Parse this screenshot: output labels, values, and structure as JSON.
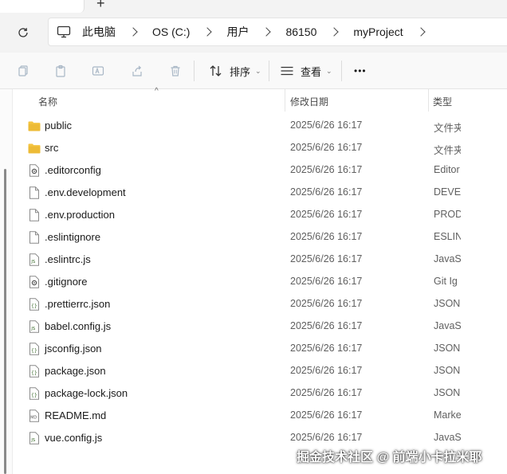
{
  "titlebar": {
    "new_tab_glyph": "+"
  },
  "address": {
    "breadcrumbs": [
      "此电脑",
      "OS (C:)",
      "用户",
      "86150",
      "myProject"
    ]
  },
  "toolbar": {
    "sort_label": "排序",
    "view_label": "查看",
    "more_glyph": "•••"
  },
  "columns": {
    "name": "名称",
    "date_modified": "修改日期",
    "type": "类型",
    "sort_indicator": "^"
  },
  "files": [
    {
      "name": "public",
      "date": "2025/6/26 16:17",
      "type": "文件夹",
      "icon": "folder-icon"
    },
    {
      "name": "src",
      "date": "2025/6/26 16:17",
      "type": "文件夹",
      "icon": "folder-icon"
    },
    {
      "name": ".editorconfig",
      "date": "2025/6/26 16:17",
      "type": "Editor",
      "icon": "gear-file-icon"
    },
    {
      "name": ".env.development",
      "date": "2025/6/26 16:17",
      "type": "DEVEL",
      "icon": "blank-file-icon"
    },
    {
      "name": ".env.production",
      "date": "2025/6/26 16:17",
      "type": "PROD",
      "icon": "blank-file-icon"
    },
    {
      "name": ".eslintignore",
      "date": "2025/6/26 16:17",
      "type": "ESLIN",
      "icon": "blank-file-icon"
    },
    {
      "name": ".eslintrc.js",
      "date": "2025/6/26 16:17",
      "type": "JavaS",
      "icon": "js-file-icon"
    },
    {
      "name": ".gitignore",
      "date": "2025/6/26 16:17",
      "type": "Git Ig",
      "icon": "gear-file-icon"
    },
    {
      "name": ".prettierrc.json",
      "date": "2025/6/26 16:17",
      "type": "JSON",
      "icon": "json-file-icon"
    },
    {
      "name": "babel.config.js",
      "date": "2025/6/26 16:17",
      "type": "JavaS",
      "icon": "js-file-icon"
    },
    {
      "name": "jsconfig.json",
      "date": "2025/6/26 16:17",
      "type": "JSON",
      "icon": "json-file-icon"
    },
    {
      "name": "package.json",
      "date": "2025/6/26 16:17",
      "type": "JSON",
      "icon": "json-file-icon"
    },
    {
      "name": "package-lock.json",
      "date": "2025/6/26 16:17",
      "type": "JSON",
      "icon": "json-file-icon"
    },
    {
      "name": "README.md",
      "date": "2025/6/26 16:17",
      "type": "Marke",
      "icon": "markdown-file-icon"
    },
    {
      "name": "vue.config.js",
      "date": "2025/6/26 16:17",
      "type": "JavaS",
      "icon": "js-file-icon"
    }
  ],
  "watermark": "掘金技术社区 @ 前端小卡拉米耶",
  "colors": {
    "folder": "#f4c542",
    "folder_dark": "#e0a820",
    "accent": "#0067c0"
  }
}
